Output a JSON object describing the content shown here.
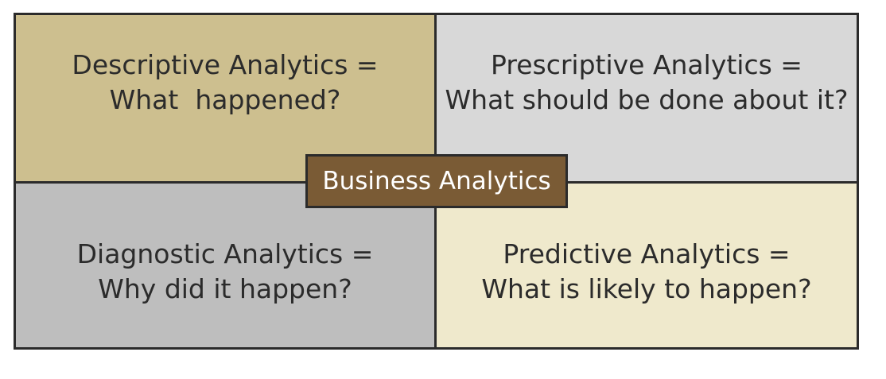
{
  "diagram": {
    "center": {
      "label": "Business Analytics",
      "color": "#7a5b35"
    },
    "quadrants": {
      "top_left": {
        "line1": "Descriptive Analytics =",
        "line2": "What  happened?",
        "color": "#cdbf8f"
      },
      "top_right": {
        "line1": "Prescriptive Analytics =",
        "line2": "What should be done about it?",
        "color": "#d8d8d8"
      },
      "bottom_left": {
        "line1": "Diagnostic Analytics =",
        "line2": "Why did it happen?",
        "color": "#bebebe"
      },
      "bottom_right": {
        "line1": "Predictive Analytics =",
        "line2": "What is likely to happen?",
        "color": "#efe9cc"
      }
    }
  }
}
